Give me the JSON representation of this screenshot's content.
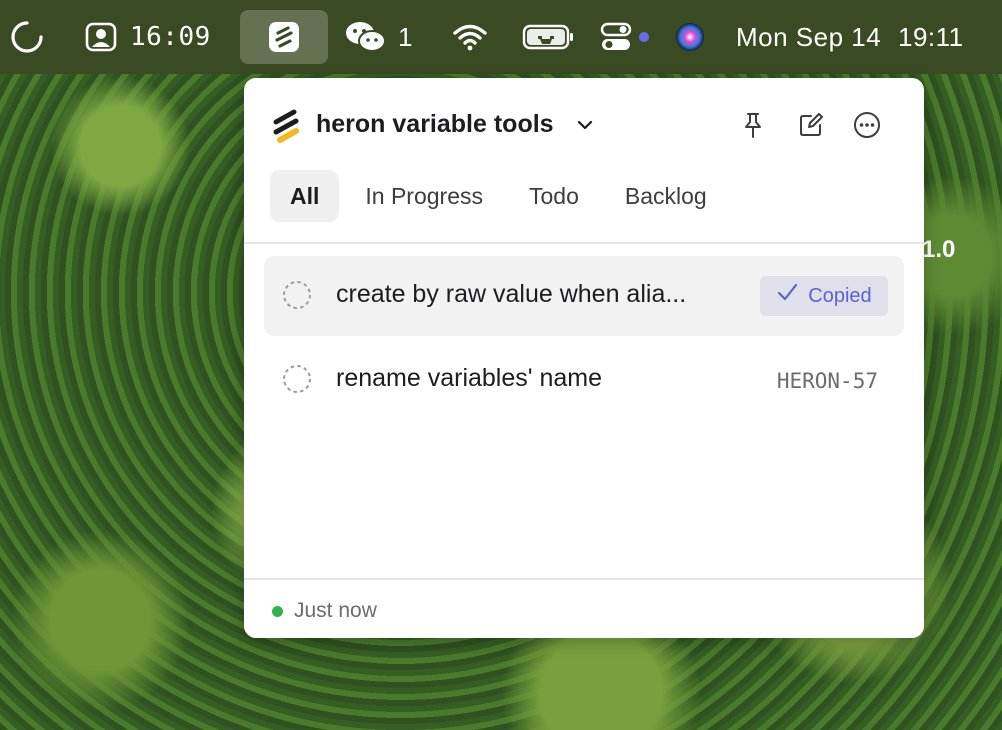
{
  "menubar": {
    "clock_left": "16:09",
    "wechat_count": "1",
    "date": "Mon Sep 14",
    "time": "19:11",
    "icons": [
      "loading-circle-icon",
      "user-card-icon",
      "linear-app-icon",
      "wechat-icon",
      "wifi-icon",
      "battery-charging-icon",
      "control-center-icon",
      "siri-icon"
    ],
    "colors": {
      "bar": "#3a4a22",
      "dot": "#6b6bf0"
    }
  },
  "background_text": "1.0",
  "popup": {
    "team_name": "heron variable tools",
    "header_buttons": [
      "pin-icon",
      "compose-icon",
      "more-icon"
    ],
    "tabs": [
      {
        "label": "All",
        "active": true
      },
      {
        "label": "In Progress",
        "active": false
      },
      {
        "label": "Todo",
        "active": false
      },
      {
        "label": "Backlog",
        "active": false
      }
    ],
    "issues": [
      {
        "title": "create by raw value when alia...",
        "badge": "Copied",
        "status": "backlog"
      },
      {
        "title": "rename variables' name",
        "id": "HERON-57",
        "status": "backlog"
      }
    ],
    "footer": {
      "sync_status": "Just now",
      "status_color": "#2fb34a"
    },
    "colors": {
      "accent": "#5a62d6",
      "badge_bg": "#dfe0ea",
      "logo_yellow": "#f6b81e"
    }
  }
}
